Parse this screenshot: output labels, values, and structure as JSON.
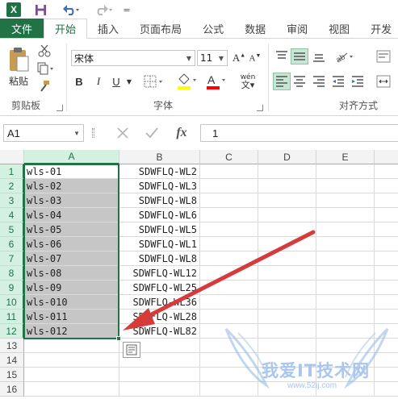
{
  "app": {
    "logo_letter": "X"
  },
  "quick_access": {
    "customize_glyph": "="
  },
  "tabs": [
    {
      "label": "文件"
    },
    {
      "label": "开始"
    },
    {
      "label": "插入"
    },
    {
      "label": "页面布局"
    },
    {
      "label": "公式"
    },
    {
      "label": "数据"
    },
    {
      "label": "审阅"
    },
    {
      "label": "视图"
    },
    {
      "label": "开发"
    }
  ],
  "ribbon": {
    "clipboard": {
      "paste_label": "粘贴",
      "group_label": "剪贴板"
    },
    "font": {
      "font_name": "宋体",
      "font_size": "11",
      "bold": "B",
      "italic": "I",
      "underline": "U",
      "phonetic": "wén",
      "group_label": "字体",
      "fill_color": "#ffff00",
      "font_color": "#ff0000"
    },
    "alignment": {
      "group_label": "对齐方式"
    }
  },
  "formula_bar": {
    "name_box": "A1",
    "fx": "fx",
    "value": "1"
  },
  "grid": {
    "columns": [
      "A",
      "B",
      "C",
      "D",
      "E"
    ],
    "rows": [
      "1",
      "2",
      "3",
      "4",
      "5",
      "6",
      "7",
      "8",
      "9",
      "10",
      "11",
      "12",
      "13",
      "14",
      "15",
      "16"
    ],
    "col_a": [
      "wls-01",
      "wls-02",
      "wls-03",
      "wls-04",
      "wls-05",
      "wls-06",
      "wls-07",
      "wls-08",
      "wls-09",
      "wls-010",
      "wls-011",
      "wls-012"
    ],
    "col_b": [
      "SDWFLQ-WL2",
      "SDWFLQ-WL3",
      "SDWFLQ-WL8",
      "SDWFLQ-WL6",
      "SDWFLQ-WL5",
      "SDWFLQ-WL1",
      "SDWFLQ-WL8",
      "SDWFLQ-WL12",
      "SDWFLQ-WL25",
      "SDWFLQ-WL36",
      "SDWFLQ-WL28",
      "SDWFLQ-WL82"
    ],
    "selection_color": "#217346"
  },
  "watermark": {
    "text": "我爱IT技术网",
    "url": "www.52ij.com"
  }
}
